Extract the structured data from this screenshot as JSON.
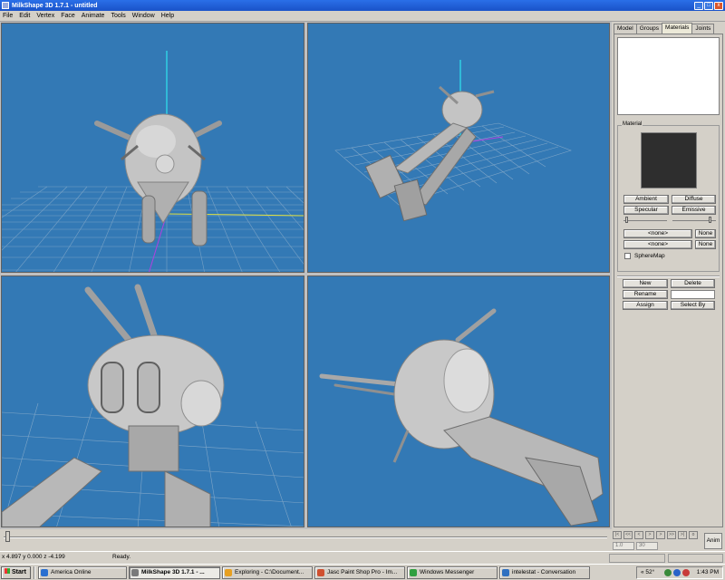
{
  "window": {
    "title": "MilkShape 3D 1.7.1 - untitled",
    "min": "_",
    "max": "□",
    "close": "x"
  },
  "menu": [
    "File",
    "Edit",
    "Vertex",
    "Face",
    "Animate",
    "Tools",
    "Window",
    "Help"
  ],
  "viewports": [
    {
      "name": "front-viewport"
    },
    {
      "name": "perspective-viewport"
    },
    {
      "name": "closeup-viewport-left"
    },
    {
      "name": "closeup-viewport-right"
    }
  ],
  "colors": {
    "viewport_bg": "#3379b5",
    "grid": "#7fa6c8",
    "model": "#c4c4c4",
    "axis_y": "#2ee6f0",
    "axis_z": "#b040e0",
    "axis_x": "#e0e040"
  },
  "panel": {
    "tabs": [
      "Model",
      "Groups",
      "Materials",
      "Joints"
    ],
    "active_tab": "Materials",
    "material_group_label": "Material",
    "ambient": "Ambient",
    "diffuse": "Diffuse",
    "specular": "Specular",
    "emissive": "Emissive",
    "tex1": "<none>",
    "tex1_btn": "None",
    "tex2": "<none>",
    "tex2_btn": "None",
    "spheremap": "SphereMap",
    "new": "New",
    "delete": "Delete",
    "rename": "Rename",
    "assign": "Assign",
    "select_by": "Select By"
  },
  "timeline": {
    "start": "1.0",
    "end": "30",
    "anim": "Anim"
  },
  "status": {
    "coords": "x 4.897 y 0.000 z -4.199",
    "message": "Ready."
  },
  "taskbar": {
    "start": "Start",
    "tasks": [
      {
        "label": "America  Online",
        "icon_color": "#2a6fd0"
      },
      {
        "label": "MilkShape 3D 1.7.1 - ...",
        "icon_color": "#7a7a7a",
        "active": true
      },
      {
        "label": "Exploring - C:\\Document...",
        "icon_color": "#e8a020"
      },
      {
        "label": "Jasc Paint Shop Pro - Im...",
        "icon_color": "#d05030"
      },
      {
        "label": "Windows Messenger",
        "icon_color": "#30a040"
      },
      {
        "label": "intelestat - Conversation",
        "icon_color": "#3070c0"
      }
    ],
    "temp": "« 52°",
    "clock": "1:43 PM"
  }
}
